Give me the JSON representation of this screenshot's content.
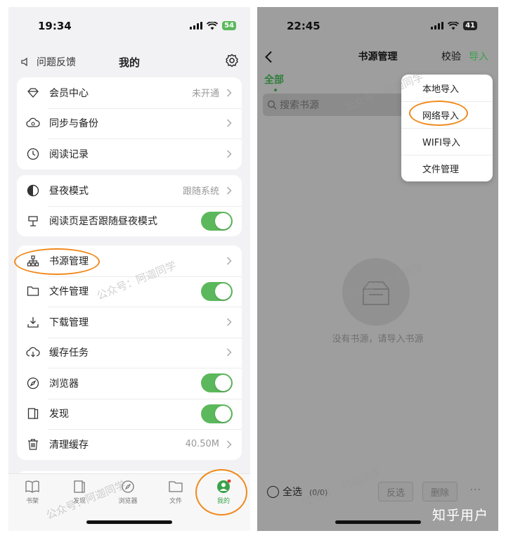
{
  "left": {
    "status": {
      "time": "19:34",
      "battery": "54"
    },
    "nav": {
      "feedback": "问题反馈",
      "title": "我的"
    },
    "group1": [
      {
        "label": "会员中心",
        "value": "未开通",
        "icon": "diamond-icon"
      },
      {
        "label": "同步与备份",
        "value": "",
        "icon": "cloud-sync-icon"
      },
      {
        "label": "阅读记录",
        "value": "",
        "icon": "clock-icon"
      }
    ],
    "group2": [
      {
        "label": "昼夜模式",
        "value": "跟随系统",
        "icon": "half-moon-icon"
      },
      {
        "label": "阅读页是否跟随昼夜模式",
        "value": "",
        "icon": "lamp-icon"
      }
    ],
    "group3": [
      {
        "label": "书源管理",
        "icon": "sitemap-icon"
      },
      {
        "label": "文件管理",
        "icon": "folder-icon"
      },
      {
        "label": "下载管理",
        "icon": "download-icon"
      },
      {
        "label": "缓存任务",
        "icon": "cloud-download-icon"
      },
      {
        "label": "浏览器",
        "icon": "compass-icon"
      },
      {
        "label": "发现",
        "icon": "book-icon"
      },
      {
        "label": "清理缓存",
        "value": "40.50M",
        "icon": "trash-icon"
      }
    ],
    "tabs": [
      {
        "label": "书架",
        "icon": "bookshelf-icon"
      },
      {
        "label": "发现",
        "icon": "discover-icon"
      },
      {
        "label": "浏览器",
        "icon": "compass-icon"
      },
      {
        "label": "文件",
        "icon": "folder-icon"
      },
      {
        "label": "我的",
        "icon": "user-icon"
      }
    ],
    "watermark": "公众号：阿迦同学"
  },
  "right": {
    "status": {
      "time": "22:45",
      "battery": "41"
    },
    "nav": {
      "title": "书源管理",
      "check": "校验",
      "import": "导入"
    },
    "tab_all": "全部",
    "search_placeholder": "搜索书源",
    "menu": [
      "本地导入",
      "网络导入",
      "WIFI导入",
      "文件管理"
    ],
    "empty": "没有书源，请导入书源",
    "bottom": {
      "select_all": "全选",
      "count": "(0/0)",
      "invert": "反选",
      "delete": "删除",
      "more": "···"
    },
    "watermark": "公众号：阿迦同学",
    "credit": "知乎用户"
  },
  "colors": {
    "accent_green": "#3aa34a",
    "highlight_orange": "#f08a1c",
    "toggle_green": "#5cb85c"
  }
}
